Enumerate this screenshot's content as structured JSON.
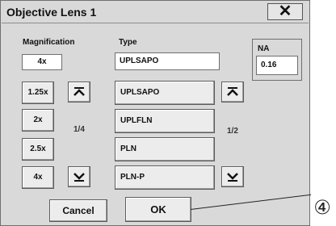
{
  "dialog": {
    "title": "Objective Lens  1",
    "close_glyph": "✕"
  },
  "magnification": {
    "label": "Magnification",
    "value": "4x",
    "options": [
      "1.25x",
      "2x",
      "2.5x",
      "4x"
    ],
    "page": "1/4"
  },
  "type": {
    "label": "Type",
    "value": "UPLSAPO",
    "options": [
      "UPLSAPO",
      "UPLFLN",
      "PLN",
      "PLN-P"
    ],
    "page": "1/2"
  },
  "na": {
    "label": "NA",
    "value": "0.16"
  },
  "buttons": {
    "cancel": "Cancel",
    "ok": "OK"
  },
  "callout": {
    "number": "④"
  },
  "icons": {
    "scroll_top": "arrow-to-top-icon",
    "scroll_bottom": "arrow-to-bottom-icon"
  }
}
